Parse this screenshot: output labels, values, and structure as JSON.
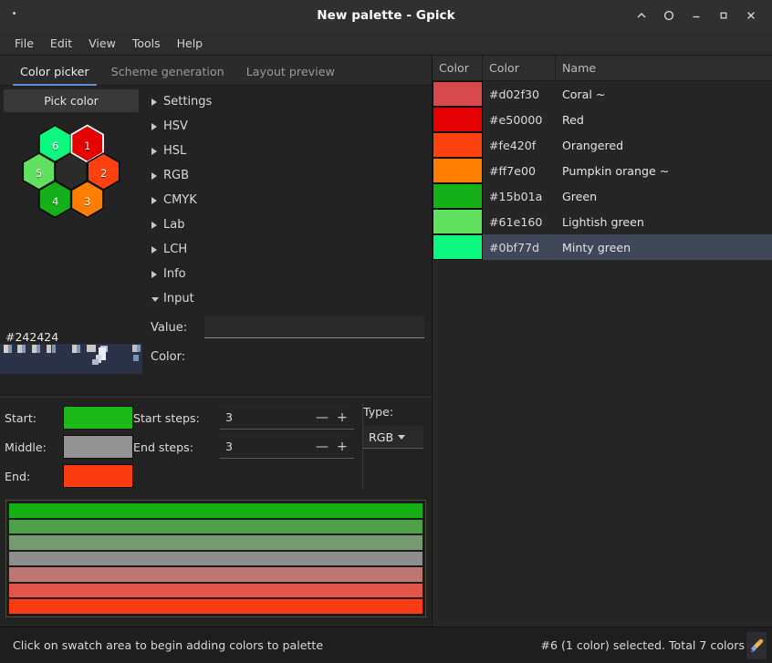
{
  "window": {
    "title": "New palette - Gpick",
    "controls": [
      {
        "name": "shade-window-button",
        "glyph": "chevron-up-icon"
      },
      {
        "name": "keep-above-button",
        "glyph": "circle-icon"
      },
      {
        "name": "minimize-button",
        "glyph": "minimize-icon"
      },
      {
        "name": "maximize-button",
        "glyph": "maximize-icon"
      },
      {
        "name": "close-button",
        "glyph": "close-icon"
      }
    ]
  },
  "menubar": {
    "items": [
      "File",
      "Edit",
      "View",
      "Tools",
      "Help"
    ]
  },
  "tabs": [
    {
      "label": "Color picker",
      "active": true
    },
    {
      "label": "Scheme generation",
      "active": false
    },
    {
      "label": "Layout preview",
      "active": false
    }
  ],
  "picker": {
    "pick_color_label": "Pick color",
    "center_hex": "#242424",
    "wheel": {
      "center_color": "#2b2b2b",
      "selected_index": 1,
      "cells": [
        {
          "index": "1",
          "color": "#e50000"
        },
        {
          "index": "2",
          "color": "#fe420f"
        },
        {
          "index": "3",
          "color": "#ff7e00"
        },
        {
          "index": "4",
          "color": "#15b01a"
        },
        {
          "index": "5",
          "color": "#61e160"
        },
        {
          "index": "6",
          "color": "#0bf77d"
        }
      ]
    },
    "magnifier_bg": "#2b3146"
  },
  "expanders": [
    {
      "label": "Settings",
      "expanded": false
    },
    {
      "label": "HSV",
      "expanded": false
    },
    {
      "label": "HSL",
      "expanded": false
    },
    {
      "label": "RGB",
      "expanded": false
    },
    {
      "label": "CMYK",
      "expanded": false
    },
    {
      "label": "Lab",
      "expanded": false
    },
    {
      "label": "LCH",
      "expanded": false
    },
    {
      "label": "Info",
      "expanded": false
    },
    {
      "label": "Input",
      "expanded": true
    }
  ],
  "input_section": {
    "value_label": "Value:",
    "value_text": "",
    "value_placeholder": "",
    "color_label": "Color:"
  },
  "gradient_controls": {
    "start_label": "Start:",
    "middle_label": "Middle:",
    "end_label": "End:",
    "start_color": "#1db916",
    "middle_color": "#949494",
    "end_color": "#fc3d12",
    "start_steps_label": "Start steps:",
    "start_steps_value": "3",
    "end_steps_label": "End steps:",
    "end_steps_value": "3",
    "minus_glyph": "—",
    "plus_glyph": "+",
    "type_label": "Type:",
    "type_value": "RGB"
  },
  "gradient_preview": {
    "bars": [
      "#16b014",
      "#4ea04a",
      "#769a70",
      "#8e8e8e",
      "#bd7670",
      "#e2564a",
      "#fb3d15"
    ]
  },
  "palette": {
    "columns": [
      "Color",
      "Color",
      "Name"
    ],
    "rows": [
      {
        "swatch": "#d8494b",
        "hex": "#d02f30",
        "name": "Coral ~",
        "selected": false
      },
      {
        "swatch": "#e50000",
        "hex": "#e50000",
        "name": "Red",
        "selected": false
      },
      {
        "swatch": "#fe420f",
        "hex": "#fe420f",
        "name": "Orangered",
        "selected": false
      },
      {
        "swatch": "#ff7e00",
        "hex": "#ff7e00",
        "name": "Pumpkin orange ~",
        "selected": false
      },
      {
        "swatch": "#15b01a",
        "hex": "#15b01a",
        "name": "Green",
        "selected": false
      },
      {
        "swatch": "#61e160",
        "hex": "#61e160",
        "name": "Lightish green",
        "selected": false
      },
      {
        "swatch": "#0bf77d",
        "hex": "#0bf77d",
        "name": "Minty green",
        "selected": true
      }
    ]
  },
  "statusbar": {
    "message": "Click on swatch area to begin adding colors to palette",
    "selection_info": "#6 (1 color) selected. Total 7 colors",
    "eyedropper_icon": "eyedropper-icon"
  },
  "colors": {
    "accent": "#5b8fd6",
    "selection_bg": "#3f4758",
    "window_bg": "#232323"
  }
}
